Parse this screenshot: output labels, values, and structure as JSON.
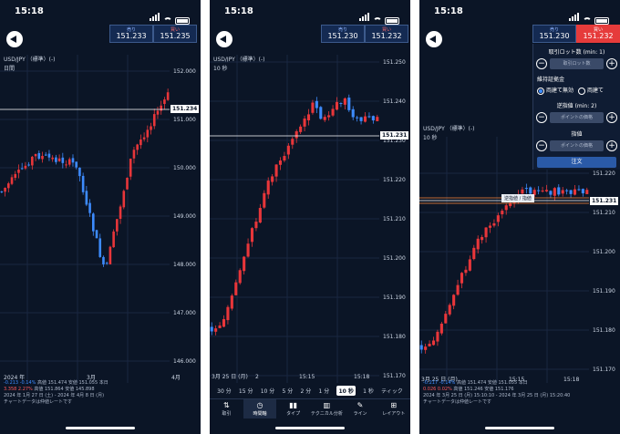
{
  "status": {
    "time": "15:18"
  },
  "phone1": {
    "sell_label": "売り",
    "sell_price": "151.233",
    "buy_label": "買い",
    "buy_price": "151.235",
    "pair": "USD/JPY （標準）(-)",
    "period": "日間",
    "price_tag": "151.234",
    "y_ticks": [
      "152.000",
      "151.000",
      "150.000",
      "149.000",
      "148.000",
      "147.000",
      "146.000"
    ],
    "x_labels": [
      "2024 年",
      "3月",
      "4月"
    ],
    "info_line1": [
      "-0.213",
      "-0.14%",
      "高値 151.474",
      "安値 151.055",
      "本日"
    ],
    "info_line2": [
      "3.358",
      "2.27%",
      "高値 151.864",
      "安値 145.898"
    ],
    "info_line3": "2024 年 1月 27 日 (土) - 2024 年 4月 8 日 (月)",
    "info_line4": "チャートデータは仲値レートです"
  },
  "phone2": {
    "sell_label": "売り",
    "sell_price": "151.230",
    "buy_label": "買い",
    "buy_price": "151.232",
    "pair": "USD/JPY （標準）(-)",
    "period": "10 秒",
    "price_tag": "151.231",
    "y_ticks": [
      "151.250",
      "151.240",
      "151.230",
      "151.220",
      "151.210",
      "151.200",
      "151.190",
      "151.180",
      "151.170"
    ],
    "x_labels": [
      "3月 25 日 (月)",
      "2",
      "15:15",
      "15:18"
    ],
    "timeframes": [
      "30 分",
      "15 分",
      "10 分",
      "5 分",
      "2 分",
      "1 分",
      "10 秒",
      "1 秒",
      "ティック"
    ],
    "tabs": [
      {
        "label": "取引",
        "icon": "⇅"
      },
      {
        "label": "時間軸",
        "icon": "◷"
      },
      {
        "label": "タイプ",
        "icon": "▮▮"
      },
      {
        "label": "テクニカル分析",
        "icon": "▥"
      },
      {
        "label": "ライン",
        "icon": "✎"
      },
      {
        "label": "レイアウト",
        "icon": "⊞"
      }
    ]
  },
  "phone3": {
    "sell_label": "売り",
    "sell_price": "151.230",
    "buy_label": "買い",
    "buy_price": "151.232",
    "pair": "USD/JPY （標準）(-)",
    "period": "10 秒",
    "price_tag": "151.231",
    "order_label": "逆指値 / 指値",
    "y_ticks": [
      "151.220",
      "151.210",
      "151.200",
      "151.190",
      "151.180",
      "151.170"
    ],
    "panel": {
      "lot_title": "取引ロット数 (min: 1)",
      "lot_placeholder": "取引ロット数",
      "margin_title": "維持証拠金",
      "radio_on": "両建て無効",
      "radio_off": "両建て",
      "stop_title": "逆指値 (min: 2)",
      "stop_placeholder": "ポイントの価格",
      "limit_title": "指値",
      "limit_placeholder": "ポイントの価格",
      "order_button": "注文"
    },
    "info_line1": [
      "-0.217",
      "-0.14%",
      "高値 151.474",
      "安値 151.055",
      "本日"
    ],
    "info_line2": [
      "0.026",
      "0.02%",
      "高値 151.246",
      "安値 151.176"
    ],
    "info_line3": "2024 年 3月 25 日 (月) 15:10:10 - 2024 年 3月 25 日 (月) 15:20:40",
    "info_line4": "チャートデータは仲値レートです",
    "x_labels": [
      "3月 25 日 (月)",
      "15:15",
      "15:18"
    ]
  },
  "colors": {
    "up": "#e8363a",
    "down": "#3d8bfd",
    "bg": "#0b1526",
    "accent": "#2a5aa8"
  }
}
